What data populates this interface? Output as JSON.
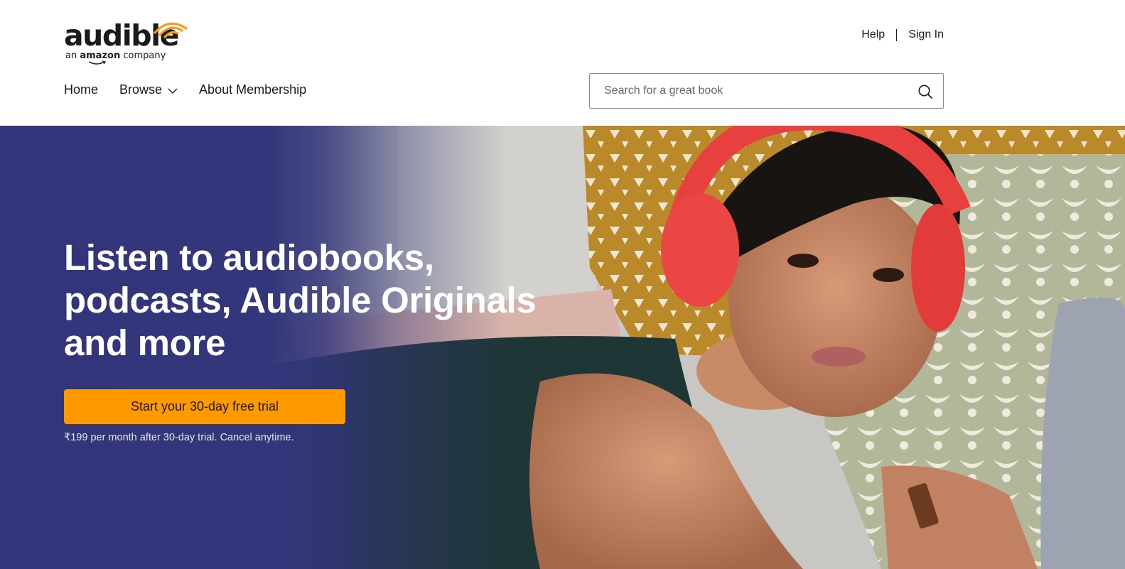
{
  "brand": {
    "logo_word": "audible",
    "logo_sub_prefix": "an",
    "logo_sub_brand": "amazon",
    "logo_sub_suffix": "company",
    "accent_color": "#ff9900",
    "hero_color": "#33357a"
  },
  "top_links": {
    "help": "Help",
    "sign_in": "Sign In"
  },
  "nav": {
    "home": "Home",
    "browse": "Browse",
    "about": "About Membership"
  },
  "search": {
    "placeholder": "Search for a great book",
    "value": "",
    "icon": "search-icon"
  },
  "hero": {
    "title": "Listen to audiobooks, podcasts, Audible Originals and more",
    "cta_label": "Start your 30-day free trial",
    "note": "₹199 per month after 30-day trial. Cancel anytime.",
    "image": "woman-with-red-headphones-photo"
  }
}
